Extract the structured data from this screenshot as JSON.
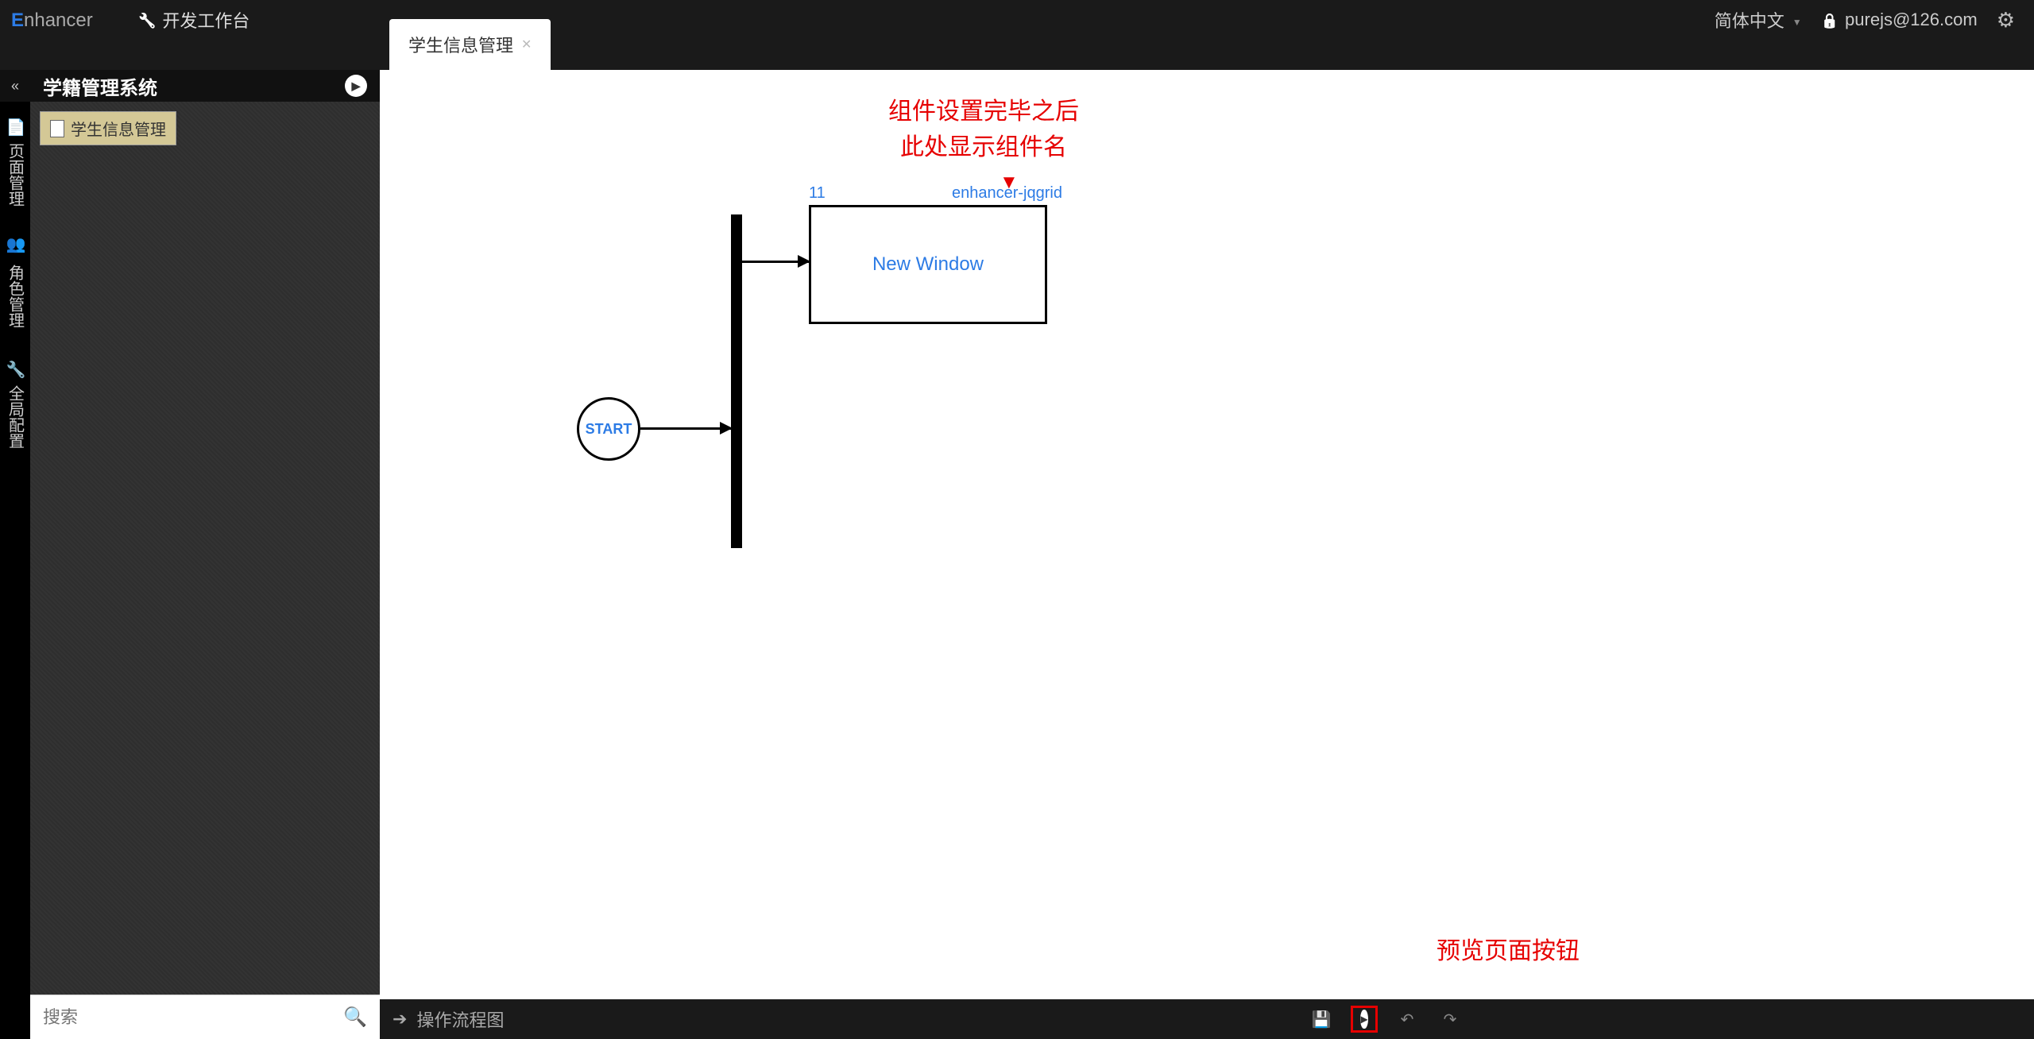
{
  "header": {
    "logo_text": "nhancer",
    "nav_workbench": "开发工作台",
    "tab_label": "学生信息管理",
    "language": "简体中文",
    "user_email": "purejs@126.com"
  },
  "left_rail": {
    "tab1": "页面管理",
    "tab2": "角色管理",
    "tab3": "全局配置"
  },
  "sidebar": {
    "title": "学籍管理系统",
    "tree_item": "学生信息管理",
    "search_placeholder": "搜索"
  },
  "canvas": {
    "annotation_line1": "组件设置完毕之后",
    "annotation_line2": "此处显示组件名",
    "node_id": "11",
    "node_type": "enhancer-jqgrid",
    "window_label": "New Window",
    "start_label": "START",
    "annotation_bottom": "预览页面按钮"
  },
  "bottom_bar": {
    "flow_label": "操作流程图"
  }
}
